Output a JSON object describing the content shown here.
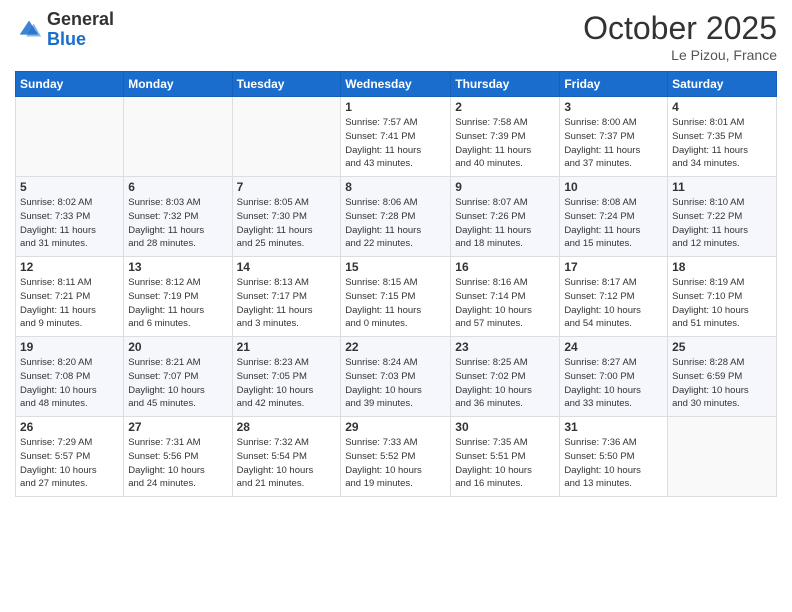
{
  "logo": {
    "general": "General",
    "blue": "Blue"
  },
  "header": {
    "month": "October 2025",
    "location": "Le Pizou, France"
  },
  "days_of_week": [
    "Sunday",
    "Monday",
    "Tuesday",
    "Wednesday",
    "Thursday",
    "Friday",
    "Saturday"
  ],
  "weeks": [
    [
      {
        "day": "",
        "info": ""
      },
      {
        "day": "",
        "info": ""
      },
      {
        "day": "",
        "info": ""
      },
      {
        "day": "1",
        "info": "Sunrise: 7:57 AM\nSunset: 7:41 PM\nDaylight: 11 hours\nand 43 minutes."
      },
      {
        "day": "2",
        "info": "Sunrise: 7:58 AM\nSunset: 7:39 PM\nDaylight: 11 hours\nand 40 minutes."
      },
      {
        "day": "3",
        "info": "Sunrise: 8:00 AM\nSunset: 7:37 PM\nDaylight: 11 hours\nand 37 minutes."
      },
      {
        "day": "4",
        "info": "Sunrise: 8:01 AM\nSunset: 7:35 PM\nDaylight: 11 hours\nand 34 minutes."
      }
    ],
    [
      {
        "day": "5",
        "info": "Sunrise: 8:02 AM\nSunset: 7:33 PM\nDaylight: 11 hours\nand 31 minutes."
      },
      {
        "day": "6",
        "info": "Sunrise: 8:03 AM\nSunset: 7:32 PM\nDaylight: 11 hours\nand 28 minutes."
      },
      {
        "day": "7",
        "info": "Sunrise: 8:05 AM\nSunset: 7:30 PM\nDaylight: 11 hours\nand 25 minutes."
      },
      {
        "day": "8",
        "info": "Sunrise: 8:06 AM\nSunset: 7:28 PM\nDaylight: 11 hours\nand 22 minutes."
      },
      {
        "day": "9",
        "info": "Sunrise: 8:07 AM\nSunset: 7:26 PM\nDaylight: 11 hours\nand 18 minutes."
      },
      {
        "day": "10",
        "info": "Sunrise: 8:08 AM\nSunset: 7:24 PM\nDaylight: 11 hours\nand 15 minutes."
      },
      {
        "day": "11",
        "info": "Sunrise: 8:10 AM\nSunset: 7:22 PM\nDaylight: 11 hours\nand 12 minutes."
      }
    ],
    [
      {
        "day": "12",
        "info": "Sunrise: 8:11 AM\nSunset: 7:21 PM\nDaylight: 11 hours\nand 9 minutes."
      },
      {
        "day": "13",
        "info": "Sunrise: 8:12 AM\nSunset: 7:19 PM\nDaylight: 11 hours\nand 6 minutes."
      },
      {
        "day": "14",
        "info": "Sunrise: 8:13 AM\nSunset: 7:17 PM\nDaylight: 11 hours\nand 3 minutes."
      },
      {
        "day": "15",
        "info": "Sunrise: 8:15 AM\nSunset: 7:15 PM\nDaylight: 11 hours\nand 0 minutes."
      },
      {
        "day": "16",
        "info": "Sunrise: 8:16 AM\nSunset: 7:14 PM\nDaylight: 10 hours\nand 57 minutes."
      },
      {
        "day": "17",
        "info": "Sunrise: 8:17 AM\nSunset: 7:12 PM\nDaylight: 10 hours\nand 54 minutes."
      },
      {
        "day": "18",
        "info": "Sunrise: 8:19 AM\nSunset: 7:10 PM\nDaylight: 10 hours\nand 51 minutes."
      }
    ],
    [
      {
        "day": "19",
        "info": "Sunrise: 8:20 AM\nSunset: 7:08 PM\nDaylight: 10 hours\nand 48 minutes."
      },
      {
        "day": "20",
        "info": "Sunrise: 8:21 AM\nSunset: 7:07 PM\nDaylight: 10 hours\nand 45 minutes."
      },
      {
        "day": "21",
        "info": "Sunrise: 8:23 AM\nSunset: 7:05 PM\nDaylight: 10 hours\nand 42 minutes."
      },
      {
        "day": "22",
        "info": "Sunrise: 8:24 AM\nSunset: 7:03 PM\nDaylight: 10 hours\nand 39 minutes."
      },
      {
        "day": "23",
        "info": "Sunrise: 8:25 AM\nSunset: 7:02 PM\nDaylight: 10 hours\nand 36 minutes."
      },
      {
        "day": "24",
        "info": "Sunrise: 8:27 AM\nSunset: 7:00 PM\nDaylight: 10 hours\nand 33 minutes."
      },
      {
        "day": "25",
        "info": "Sunrise: 8:28 AM\nSunset: 6:59 PM\nDaylight: 10 hours\nand 30 minutes."
      }
    ],
    [
      {
        "day": "26",
        "info": "Sunrise: 7:29 AM\nSunset: 5:57 PM\nDaylight: 10 hours\nand 27 minutes."
      },
      {
        "day": "27",
        "info": "Sunrise: 7:31 AM\nSunset: 5:56 PM\nDaylight: 10 hours\nand 24 minutes."
      },
      {
        "day": "28",
        "info": "Sunrise: 7:32 AM\nSunset: 5:54 PM\nDaylight: 10 hours\nand 21 minutes."
      },
      {
        "day": "29",
        "info": "Sunrise: 7:33 AM\nSunset: 5:52 PM\nDaylight: 10 hours\nand 19 minutes."
      },
      {
        "day": "30",
        "info": "Sunrise: 7:35 AM\nSunset: 5:51 PM\nDaylight: 10 hours\nand 16 minutes."
      },
      {
        "day": "31",
        "info": "Sunrise: 7:36 AM\nSunset: 5:50 PM\nDaylight: 10 hours\nand 13 minutes."
      },
      {
        "day": "",
        "info": ""
      }
    ]
  ]
}
